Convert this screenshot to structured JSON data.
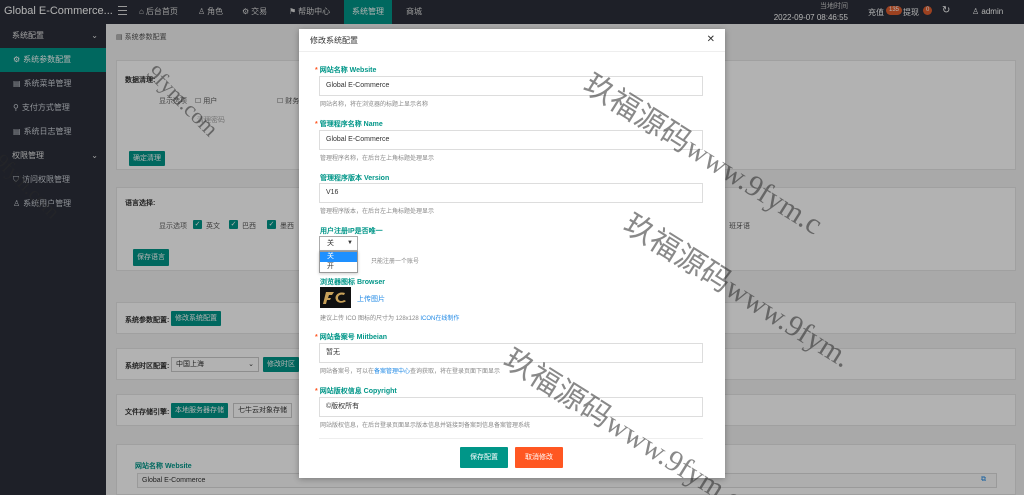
{
  "app": {
    "brand": "Global E-Commerce..."
  },
  "topnav": {
    "items": [
      {
        "icon": "home-icon",
        "glyph": "⌂",
        "label": "后台首页"
      },
      {
        "icon": "user-icon",
        "glyph": "♙",
        "label": "角色"
      },
      {
        "icon": "gear-icon",
        "glyph": "⚙",
        "label": "交易"
      },
      {
        "icon": "flag-icon",
        "glyph": "⚑",
        "label": "帮助中心"
      },
      {
        "icon": "",
        "glyph": "",
        "label": "系统管理"
      },
      {
        "icon": "",
        "glyph": "",
        "label": "商城"
      }
    ],
    "time_label": "当地时间",
    "time_value": "2022-09-07 08:46:55",
    "recharge_label": "充值",
    "recharge_badge": "135",
    "withdraw_label": "提现",
    "withdraw_badge": "0",
    "user": "admin"
  },
  "sidebar": {
    "group1": "系统配置",
    "items1": [
      "系统参数配置",
      "系统菜单管理",
      "支付方式管理",
      "系统日志管理"
    ],
    "group2": "权限管理",
    "items2": [
      "访问权限管理",
      "系统用户管理"
    ]
  },
  "breadcrumb": "系统参数配置",
  "background": {
    "data_clean_label": "数据清理:",
    "display_label": "显示选项",
    "user_option": "用户",
    "finance_option": "财务",
    "clean_placeholder": "清理密码",
    "confirm_clean": "确定清理",
    "lang_label": "语言选择:",
    "lang_display_label": "显示选项",
    "langs": [
      "英文",
      "巴西",
      "墨西"
    ],
    "lang_right": "班牙语",
    "save_lang": "保存语言",
    "sys_param_label": "系统参数配置:",
    "modify_sys_config": "修改系统配置",
    "timezone_label": "系统时区配置:",
    "timezone_value": "中国上海",
    "modify_timezone": "修改时区",
    "storage_label": "文件存储引擎:",
    "storage_local": "本地服务器存储",
    "storage_qiniu": "七牛云对象存储",
    "site_name_label": "网站名称 Website",
    "site_name_value": "Global E-Commerce"
  },
  "modal": {
    "title": "修改系统配置",
    "site_name_label": "网站名称 Website",
    "site_name_value": "Global E-Commerce",
    "site_name_help": "网站名称，将在浏览器的标题上显示名称",
    "admin_name_label": "管理程序名称 Name",
    "admin_name_value": "Global E-Commerce",
    "admin_name_help": "管理程序名称，在后台左上角标题处理显示",
    "version_label": "管理程序版本 Version",
    "version_value": "V16",
    "version_help": "管理程序版本，在后台左上角标题处理显示",
    "ip_unique_label": "用户注册IP是否唯一",
    "ip_unique_value": "关",
    "ip_unique_options": [
      "关",
      "开"
    ],
    "ip_unique_help": "只能注册一个账号",
    "browser_icon_label": "浏览器图标 Browser",
    "upload_label": "上传图片",
    "browser_icon_help": "建议上传 ICO 图标的尺寸为 128x128",
    "icon_online_link": "ICON在线制作",
    "beian_label": "网站备案号 Miitbeian",
    "beian_value": "暂无",
    "beian_help_pre": "网站备案号，可以在",
    "beian_help_link": "备案管理中心",
    "beian_help_post": "查询获取，将在登录页面下面显示",
    "copyright_label": "网站版权信息 Copyright",
    "copyright_value": "©版权所有",
    "copyright_help": "网站版权信息，在后台登录页面显示版本信息并链接到备案到信息备案管理系统",
    "save_button": "保存配置",
    "cancel_button": "取消修改"
  },
  "watermark": {
    "text1": "9fym.com",
    "text2": "玖福源码www.9fym.c",
    "text3": "玖福源码www.9fym.",
    "text4": "玖福源码www.9fym.c",
    "text5": "9fym.com"
  }
}
